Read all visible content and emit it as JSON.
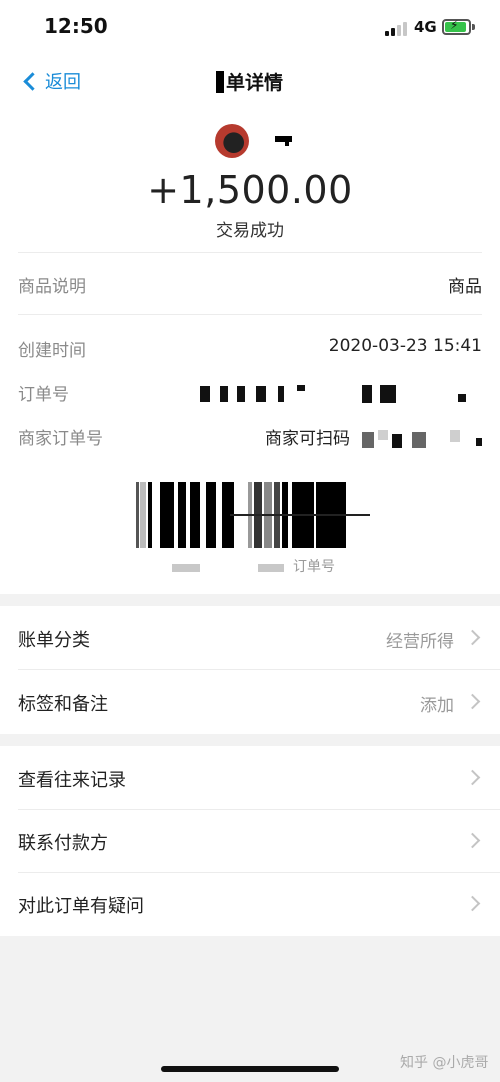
{
  "status_bar": {
    "time": "12:50",
    "network": "4G"
  },
  "nav": {
    "back_label": "返回",
    "title": "单详情"
  },
  "detail": {
    "amount": "+1,500.00",
    "status": "交易成功",
    "rows": {
      "product_label": "商品说明",
      "product_value": "商品",
      "created_label": "创建时间",
      "created_value": "2020-03-23 15:41",
      "order_no_label": "订单号",
      "merchant_order_label": "商家订单号",
      "merchant_order_value": "商家可扫码"
    },
    "barcode_caption": "订单号"
  },
  "group1": {
    "category_label": "账单分类",
    "category_value": "经营所得",
    "tags_label": "标签和备注",
    "tags_value": "添加"
  },
  "group2": {
    "history_label": "查看往来记录",
    "contact_label": "联系付款方",
    "question_label": "对此订单有疑问"
  },
  "watermark": "知乎 @小虎哥",
  "colors": {
    "accent": "#1a8cd8",
    "battery": "#36c24a"
  },
  "icons": [
    "back-chevron-icon",
    "signal-icon",
    "battery-icon",
    "chevron-right-icon"
  ]
}
